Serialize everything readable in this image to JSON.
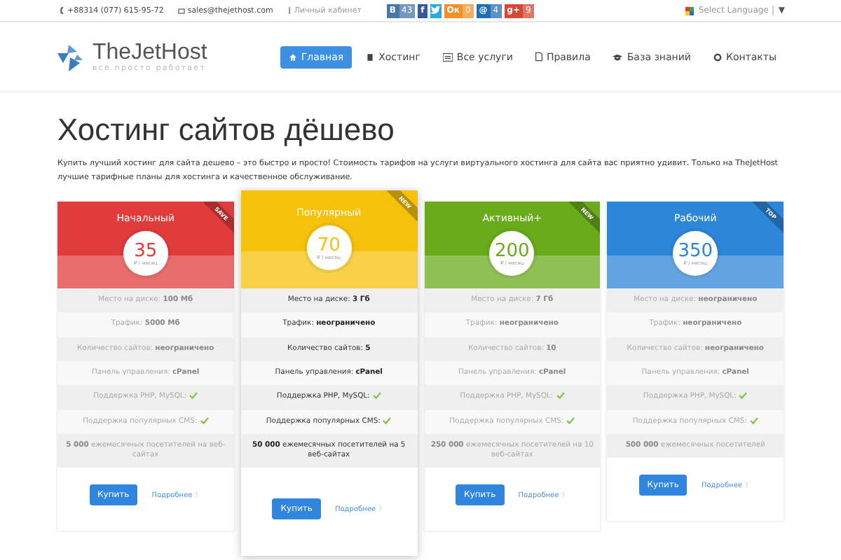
{
  "topbar": {
    "phone": "+88314 (077) 615-95-72",
    "email": "sales@thejethost.com",
    "cabinet": "Личный кабинет",
    "socials": [
      {
        "kind": "vk",
        "label": "В",
        "count": "43",
        "color": "#4a76a8"
      },
      {
        "kind": "fb",
        "label": "f",
        "color": "#3b5998"
      },
      {
        "kind": "tw",
        "color": "#29a9e1"
      },
      {
        "kind": "ok",
        "label": "Ок",
        "count": "0",
        "color": "#f2902a"
      },
      {
        "kind": "mail",
        "label": "@",
        "count": "4",
        "color": "#1f6fb5"
      },
      {
        "kind": "gp",
        "label": "g+",
        "count": "9",
        "color": "#d34836"
      }
    ],
    "language": "Select Language",
    "language_caret": "▼"
  },
  "header": {
    "logo": "TheJetHost",
    "tagline": "все просто работает",
    "nav": [
      {
        "label": "Главная",
        "selected": true
      },
      {
        "label": "Хостинг",
        "selected": false
      },
      {
        "label": "Все услуги",
        "selected": false
      },
      {
        "label": "Правила",
        "selected": false
      },
      {
        "label": "База знаний",
        "selected": false
      },
      {
        "label": "Контакты",
        "selected": false
      }
    ]
  },
  "title": "Хостинг сайтов дёшево",
  "intro": "Купить лучший хостинг для сайта дешево – это быстро и просто! Стоимость тарифов на услуги виртуального хостинга для сайта вас приятно удивит. Только на TheJetHost лучшие тарифные планы для хостинга и качественное обслуживание.",
  "plans": [
    {
      "name": "Начальный",
      "ribbon": "SAVE",
      "price": "35",
      "period": "₽ / месяц",
      "color": "#e03c3c",
      "featured": false,
      "features": [
        {
          "text": "Место на диске: **100 Мб**",
          "check": false
        },
        {
          "text": "Трафик: **5000 Мб**",
          "check": false
        },
        {
          "text": "Количество сайтов: **неограничено**",
          "check": false
        },
        {
          "text": "Панель управления: **cPanel**",
          "check": false
        },
        {
          "text": "Поддержка PHP, MySQL:",
          "check": true
        },
        {
          "text": "Поддержка популярных CMS:",
          "check": true
        },
        {
          "text": "**5 000** ежемесячных посетителей на веб-сайтах",
          "check": false
        }
      ],
      "buy": "Купить",
      "more": "Подробнее",
      "more_caret": "〉"
    },
    {
      "name": "Популярный",
      "ribbon": "NEW",
      "price": "70",
      "period": "₽ / месяц",
      "color": "#f5c10a",
      "featured": true,
      "features": [
        {
          "text": "Место на диске: **3 Гб**",
          "check": false
        },
        {
          "text": "Трафик: **неограничено**",
          "check": false
        },
        {
          "text": "Количество сайтов: **5**",
          "check": false
        },
        {
          "text": "Панель управления: **cPanel**",
          "check": false
        },
        {
          "text": "Поддержка PHP, MySQL:",
          "check": true
        },
        {
          "text": "Поддержка популярных CMS:",
          "check": true
        },
        {
          "text": "**50 000** ежемесячных посетителей на 5 веб-сайтах",
          "check": false
        }
      ],
      "buy": "Купить",
      "more": "Подробнее",
      "more_caret": "〉"
    },
    {
      "name": "Активный+",
      "ribbon": "NEW",
      "price": "200",
      "period": "₽ / месяц",
      "color": "#6aab1c",
      "featured": false,
      "features": [
        {
          "text": "Место на диске: **7 Гб**",
          "check": false
        },
        {
          "text": "Трафик: **неограничено**",
          "check": false
        },
        {
          "text": "Количество сайтов: **10**",
          "check": false
        },
        {
          "text": "Панель управления: **cPanel**",
          "check": false
        },
        {
          "text": "Поддержка PHP, MySQL:",
          "check": true
        },
        {
          "text": "Поддержка популярных CMS:",
          "check": true
        },
        {
          "text": "**250 000** ежемесячных посетителей на 10 веб-сайтах",
          "check": false
        }
      ],
      "buy": "Купить",
      "more": "Подробнее",
      "more_caret": "〉"
    },
    {
      "name": "Рабочий",
      "ribbon": "TOP",
      "price": "350",
      "period": "₽ / месяц",
      "color": "#2e86d8",
      "featured": false,
      "features": [
        {
          "text": "Место на диске: **неограничено**",
          "check": false
        },
        {
          "text": "Трафик: **неограничено**",
          "check": false
        },
        {
          "text": "Количество сайтов: **неограничено**",
          "check": false
        },
        {
          "text": "Панель управления: **cPanel**",
          "check": false
        },
        {
          "text": "Поддержка PHP, MySQL:",
          "check": true
        },
        {
          "text": "Поддержка популярных CMS:",
          "check": true
        },
        {
          "text": "**500 000** ежемесячных посетителей",
          "check": false
        }
      ],
      "buy": "Купить",
      "more": "Подробнее",
      "more_caret": "〉"
    }
  ]
}
